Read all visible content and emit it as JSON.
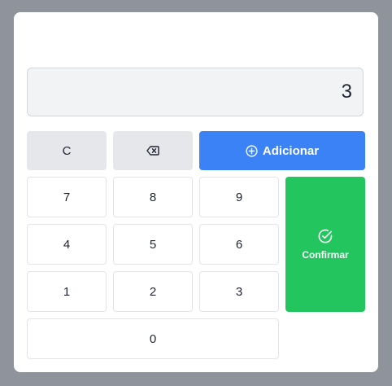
{
  "display": {
    "value": "3"
  },
  "actions": {
    "clear_label": "C",
    "backspace_icon": "backspace-icon",
    "add_label": "Adicionar",
    "add_icon": "plus-circle-icon",
    "confirm_label": "Confirmar",
    "confirm_icon": "check-circle-icon"
  },
  "keys": {
    "k7": "7",
    "k8": "8",
    "k9": "9",
    "k4": "4",
    "k5": "5",
    "k6": "6",
    "k1": "1",
    "k2": "2",
    "k3": "3",
    "k0": "0"
  },
  "colors": {
    "overlay": "#8e939c",
    "add_button": "#3b82f6",
    "confirm_button": "#22c55e",
    "gray_button": "#e5e7eb",
    "display_bg": "#f2f3f5"
  }
}
